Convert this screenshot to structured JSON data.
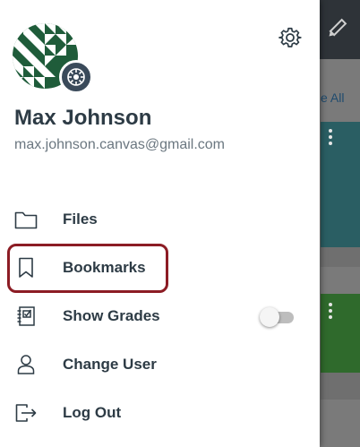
{
  "background": {
    "see_all_label": "e All"
  },
  "drawer": {
    "user": {
      "name": "Max Johnson",
      "email": "max.johnson.canvas@gmail.com"
    },
    "menu": [
      {
        "label": "Files",
        "icon": "folder-icon"
      },
      {
        "label": "Bookmarks",
        "icon": "bookmark-icon"
      },
      {
        "label": "Show Grades",
        "icon": "grades-icon",
        "toggle_on": false
      },
      {
        "label": "Change User",
        "icon": "user-icon"
      },
      {
        "label": "Log Out",
        "icon": "logout-icon"
      }
    ]
  },
  "colors": {
    "text_primary": "#2d3b45",
    "text_secondary": "#6b7780",
    "highlight_border": "#8c1c24",
    "toolbar": "#2e3338",
    "card_teal": "#2a5e63",
    "card_green": "#2f6a2c"
  }
}
